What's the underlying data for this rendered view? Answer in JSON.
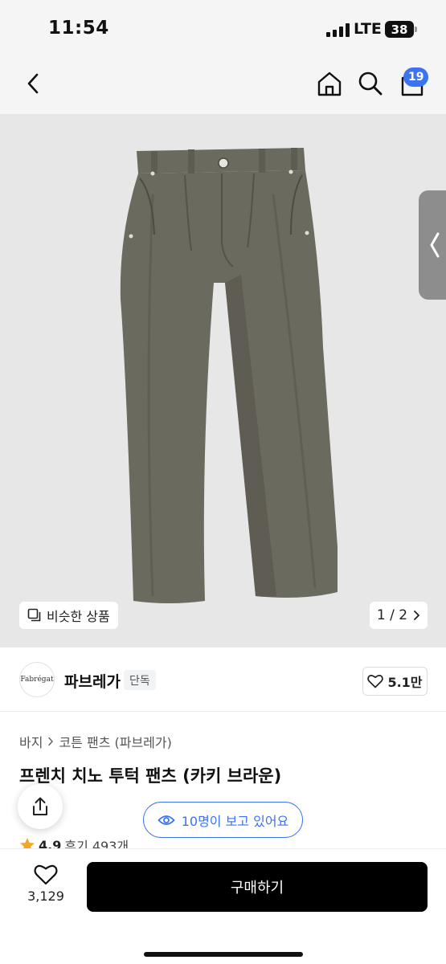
{
  "status": {
    "time": "11:54",
    "network": "LTE",
    "battery": "38"
  },
  "nav": {
    "cart_count": "19"
  },
  "image": {
    "similar_label": "비슷한 상품",
    "pager": "1 / 2"
  },
  "brand": {
    "logo_text": "Fabrégat",
    "name": "파브레가",
    "tag": "단독",
    "likes": "5.1만"
  },
  "product": {
    "breadcrumb": [
      "바지",
      "코튼 팬츠 (파브레가)"
    ],
    "title": "프렌치 치노 투턱 팬츠 (카키 브라운)",
    "rating": "4.9",
    "reviews": "후기 493개",
    "viewers": "10명이 보고 있어요"
  },
  "bottom": {
    "wish_count": "3,129",
    "buy_label": "구매하기"
  },
  "icons": {
    "back": "chevron-left-icon",
    "home": "home-icon",
    "search": "search-icon",
    "cart": "cart-icon",
    "share": "share-icon",
    "heart": "heart-icon",
    "eye": "eye-icon",
    "star": "star-icon"
  },
  "colors": {
    "accent": "#3b73f0",
    "pants": "#6b6a5f",
    "star": "#f5a623"
  }
}
